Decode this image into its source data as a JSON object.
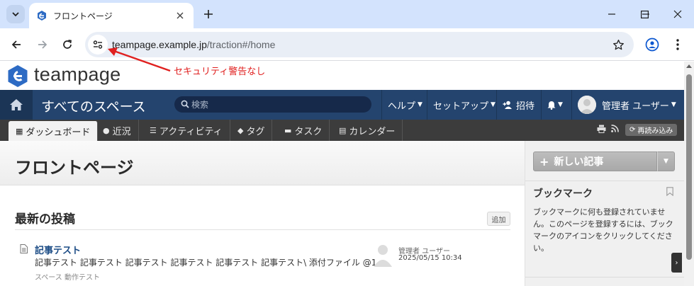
{
  "browser": {
    "tab_title": "フロントページ",
    "url_host": "teampage.example.jp",
    "url_path": "/traction#/home"
  },
  "annotation": {
    "text": "セキュリティ警告なし",
    "color": "#e0201f"
  },
  "app": {
    "logo_text": "teampage",
    "space_title": "すべてのスペース",
    "search_placeholder": "検索",
    "nav": {
      "help": "ヘルプ",
      "setup": "セットアップ",
      "invite": "招待",
      "user": "管理者 ユーザー"
    },
    "tabs": [
      {
        "label": "ダッシュボード",
        "icon": "grid-icon"
      },
      {
        "label": "近況",
        "icon": "chat-icon"
      },
      {
        "label": "アクティビティ",
        "icon": "list-icon"
      },
      {
        "label": "タグ",
        "icon": "tag-icon"
      },
      {
        "label": "タスク",
        "icon": "task-icon"
      },
      {
        "label": "カレンダー",
        "icon": "calendar-icon"
      }
    ],
    "reload_label": "再読み込み",
    "colors": {
      "navbar": "#24446e",
      "subnav": "#3c3c3c",
      "accent": "#1d4d86"
    }
  },
  "main": {
    "page_title": "フロントページ",
    "section_title": "最新の投稿",
    "add_label": "追加",
    "posts": [
      {
        "title": "記事テスト",
        "body": "記事テスト 記事テスト 記事テスト 記事テスト 記事テスト 記事テスト\\ 添付ファイル @1",
        "space": "スペース 動作テスト",
        "author": "管理者 ユーザー",
        "date": "2025/05/15 10:34"
      }
    ]
  },
  "sidebar": {
    "new_article": "新しい記事",
    "bookmark_title": "ブックマーク",
    "bookmark_desc": "ブックマークに何も登録されていません。このページを登録するには、ブックマークのアイコンをクリックしてください。"
  }
}
